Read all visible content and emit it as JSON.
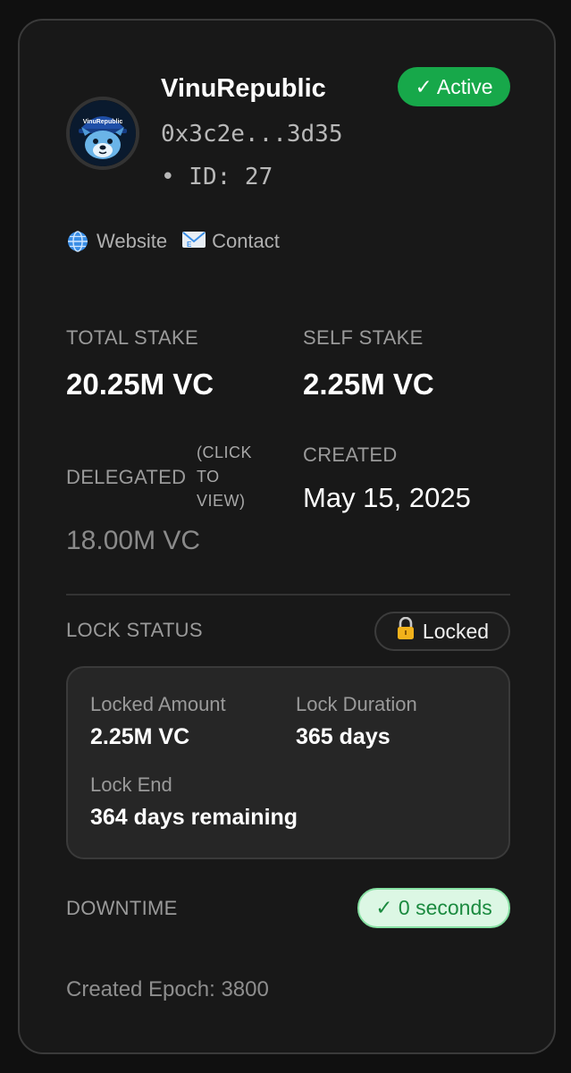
{
  "validator": {
    "name": "VinuRepublic",
    "address": "0x3c2e...3d35",
    "id_label": "• ID: 27",
    "status": "✓ Active",
    "status_color": "#17a84a",
    "logo_text": "VinuRepublic"
  },
  "links": [
    {
      "icon": "globe-icon",
      "glyph": "🌐",
      "label": "Website"
    },
    {
      "icon": "mail-icon",
      "glyph": "📧",
      "label": "Contact"
    }
  ],
  "stats": {
    "total_stake_label": "TOTAL STAKE",
    "total_stake_value": "20.25M VC",
    "self_stake_label": "SELF STAKE",
    "self_stake_value": "2.25M VC",
    "delegated_label": "DELEGATED",
    "delegated_hint": "(CLICK TO VIEW)",
    "delegated_value": "18.00M VC",
    "created_label": "CREATED",
    "created_value": "May 15, 2025"
  },
  "lock": {
    "section_label": "LOCK STATUS",
    "badge_icon": "lock-icon",
    "badge_glyph": "🔒",
    "badge_label": "Locked",
    "locked_amount_label": "Locked Amount",
    "locked_amount_value": "2.25M VC",
    "lock_duration_label": "Lock Duration",
    "lock_duration_value": "365 days",
    "lock_end_label": "Lock End",
    "lock_end_value": "364 days remaining"
  },
  "downtime": {
    "label": "DOWNTIME",
    "badge": "✓ 0 seconds",
    "badge_color": "#1b8a3f"
  },
  "footer": {
    "created_epoch": "Created Epoch: 3800"
  }
}
